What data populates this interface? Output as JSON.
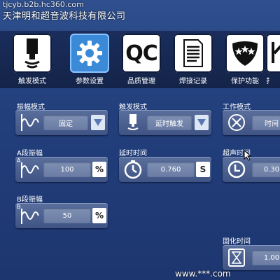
{
  "watermark": {
    "url": "tjcyb.b2b.hc360.com",
    "company": "天津明和超音波科技有限公司",
    "footer": "www.***.com"
  },
  "nav": {
    "tabs": [
      {
        "label": "触发模式",
        "icon": "sensor-probe-icon",
        "active": false
      },
      {
        "label": "参数设置",
        "icon": "gear-icon",
        "active": true
      },
      {
        "label": "QC",
        "sublabel": "品质管理",
        "icon": "qc-icon",
        "active": false
      },
      {
        "label": "焊接记录",
        "icon": "document-list-icon",
        "active": false
      },
      {
        "label": "保护功能",
        "icon": "shield-stars-icon",
        "active": false
      },
      {
        "label": "扌",
        "icon": "partial-tab-icon",
        "active": false
      }
    ]
  },
  "fields": {
    "amplitude_mode": {
      "label": "振幅模式",
      "value": "固定"
    },
    "trigger_mode": {
      "label": "触发模式",
      "value": "延时触发"
    },
    "work_mode": {
      "label": "工作模式",
      "value": "时间"
    },
    "a_amplitude": {
      "label": "A段振幅",
      "letter": "A",
      "value": "100",
      "unit": "%"
    },
    "delay_time": {
      "label": "延时时间",
      "value": "0.760",
      "unit": "S"
    },
    "ultrasonic_time": {
      "label": "超声时间",
      "value": "0.30"
    },
    "b_amplitude": {
      "label": "B段振幅",
      "letter": "B",
      "value": "50",
      "unit": "%"
    },
    "cure_time": {
      "label": "固化时间",
      "value": "1.00"
    }
  },
  "colors": {
    "background": "#223f7c",
    "nav_active": "#3a8ad8",
    "panel": "#4a5f90",
    "value_box": "#7586ab"
  }
}
